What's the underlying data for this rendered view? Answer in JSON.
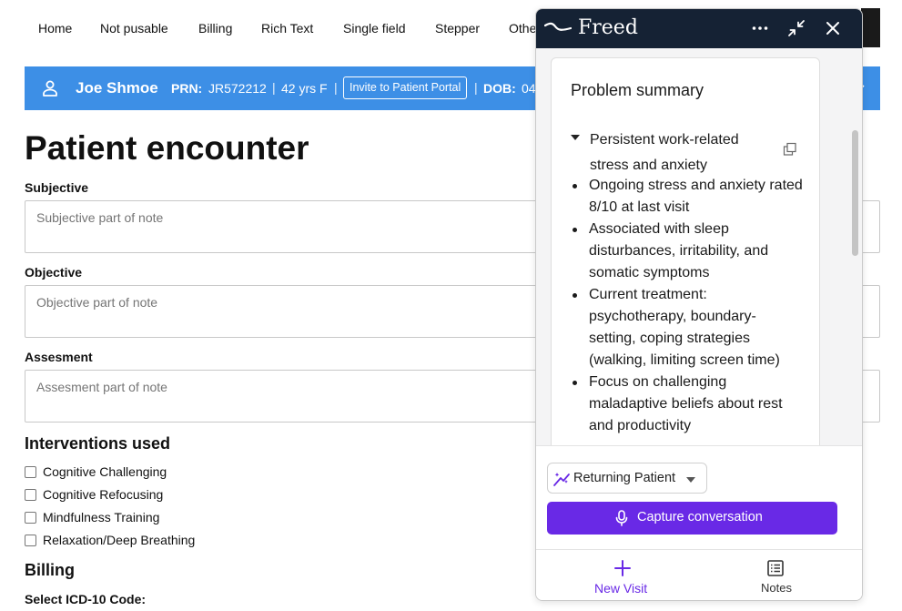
{
  "nav": {
    "items": [
      "Home",
      "Not pusable",
      "Billing",
      "Rich Text",
      "Single field",
      "Stepper",
      "Othe"
    ]
  },
  "patient": {
    "name": "Joe Shmoe",
    "prn_label": "PRN:",
    "prn_value": "JR572212",
    "separator": "|",
    "age_sex": "42 yrs F",
    "invite_label": "Invite to Patient Portal",
    "dob_label": "DOB:",
    "dob_value": "04"
  },
  "form": {
    "title": "Patient encounter",
    "subjective": {
      "label": "Subjective",
      "placeholder": "Subjective part of note"
    },
    "objective": {
      "label": "Objective",
      "placeholder": "Objective part of note"
    },
    "assessment": {
      "label": "Assesment",
      "placeholder": "Assesment part of note"
    },
    "interventions_heading": "Interventions used",
    "interventions": [
      "Cognitive Challenging",
      "Cognitive Refocusing",
      "Mindfulness Training",
      "Relaxation/Deep Breathing"
    ],
    "billing_heading": "Billing",
    "icd_label": "Select ICD-10 Code:"
  },
  "freed": {
    "brand": "Freed",
    "summary_title": "Problem summary",
    "problem_title": "Persistent work-related stress and anxiety",
    "bullets": [
      "Ongoing stress and anxiety rated 8/10 at last visit",
      "Associated with sleep disturbances, irritability, and somatic symptoms",
      "Current treatment: psychotherapy, boundary-setting, coping strategies (walking, limiting screen time)",
      "Focus on challenging maladaptive beliefs about rest and productivity"
    ],
    "visit_type": "Returning Patient",
    "capture_label": "Capture conversation",
    "footer": {
      "new_visit": "New Visit",
      "notes": "Notes"
    }
  },
  "colors": {
    "banner": "#3d8fe6",
    "freed_header": "#152234",
    "freed_accent": "#6929e6"
  }
}
